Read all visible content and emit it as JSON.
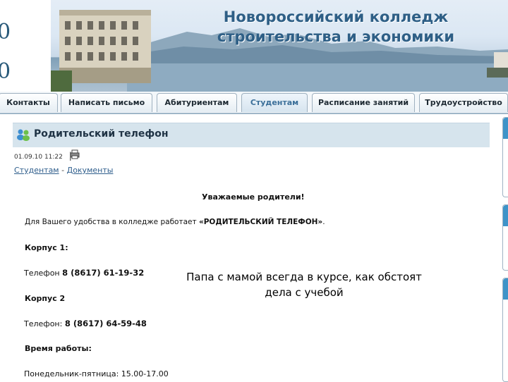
{
  "header": {
    "left_glyph_1": "0",
    "left_glyph_2": "0",
    "title_line1": "Новороссийский колледж",
    "title_line2": "строительства и экономики"
  },
  "nav": {
    "tabs": [
      {
        "label": "Контакты",
        "active": false
      },
      {
        "label": "Написать письмо",
        "active": false
      },
      {
        "label": "Абитуриентам",
        "active": false
      },
      {
        "label": "Студентам",
        "active": true
      },
      {
        "label": "Расписание занятий",
        "active": false
      },
      {
        "label": "Трудоустройство",
        "active": false
      }
    ]
  },
  "article": {
    "title": "Родительский телефон",
    "date": "01.09.10 11:22",
    "meta_separator": "|",
    "breadcrumb": {
      "item1": "Студентам",
      "separator": " - ",
      "item2": "Документы"
    },
    "greeting": "Уважаемые родители!",
    "intro_prefix": "Для Вашего удобства в колледже работает ",
    "intro_bold": "«РОДИТЕЛЬСКИЙ ТЕЛЕФОН»",
    "intro_suffix": ".",
    "building1_label": "Корпус 1:",
    "phone1_prefix": "Телефон ",
    "phone1_number": "8 (8617) 61-19-32",
    "building2_label": "Корпус 2",
    "phone2_prefix": "Телефон: ",
    "phone2_number": "8 (8617) 64-59-48",
    "hours_label": "Время работы:",
    "hours_value": "Понедельник-пятница: 15.00-17.00"
  },
  "overlay": {
    "line1": "Папа с мамой всегда в курсе, как обстоят",
    "line2": "дела с учебой"
  },
  "icons": {
    "title": "people-icon",
    "print": "printer-icon"
  },
  "colors": {
    "title_blue": "#2e5f86",
    "title_bar": "#d6e4ed",
    "link": "#2f5e8c",
    "side_tab_accent": "#3e93c8"
  }
}
